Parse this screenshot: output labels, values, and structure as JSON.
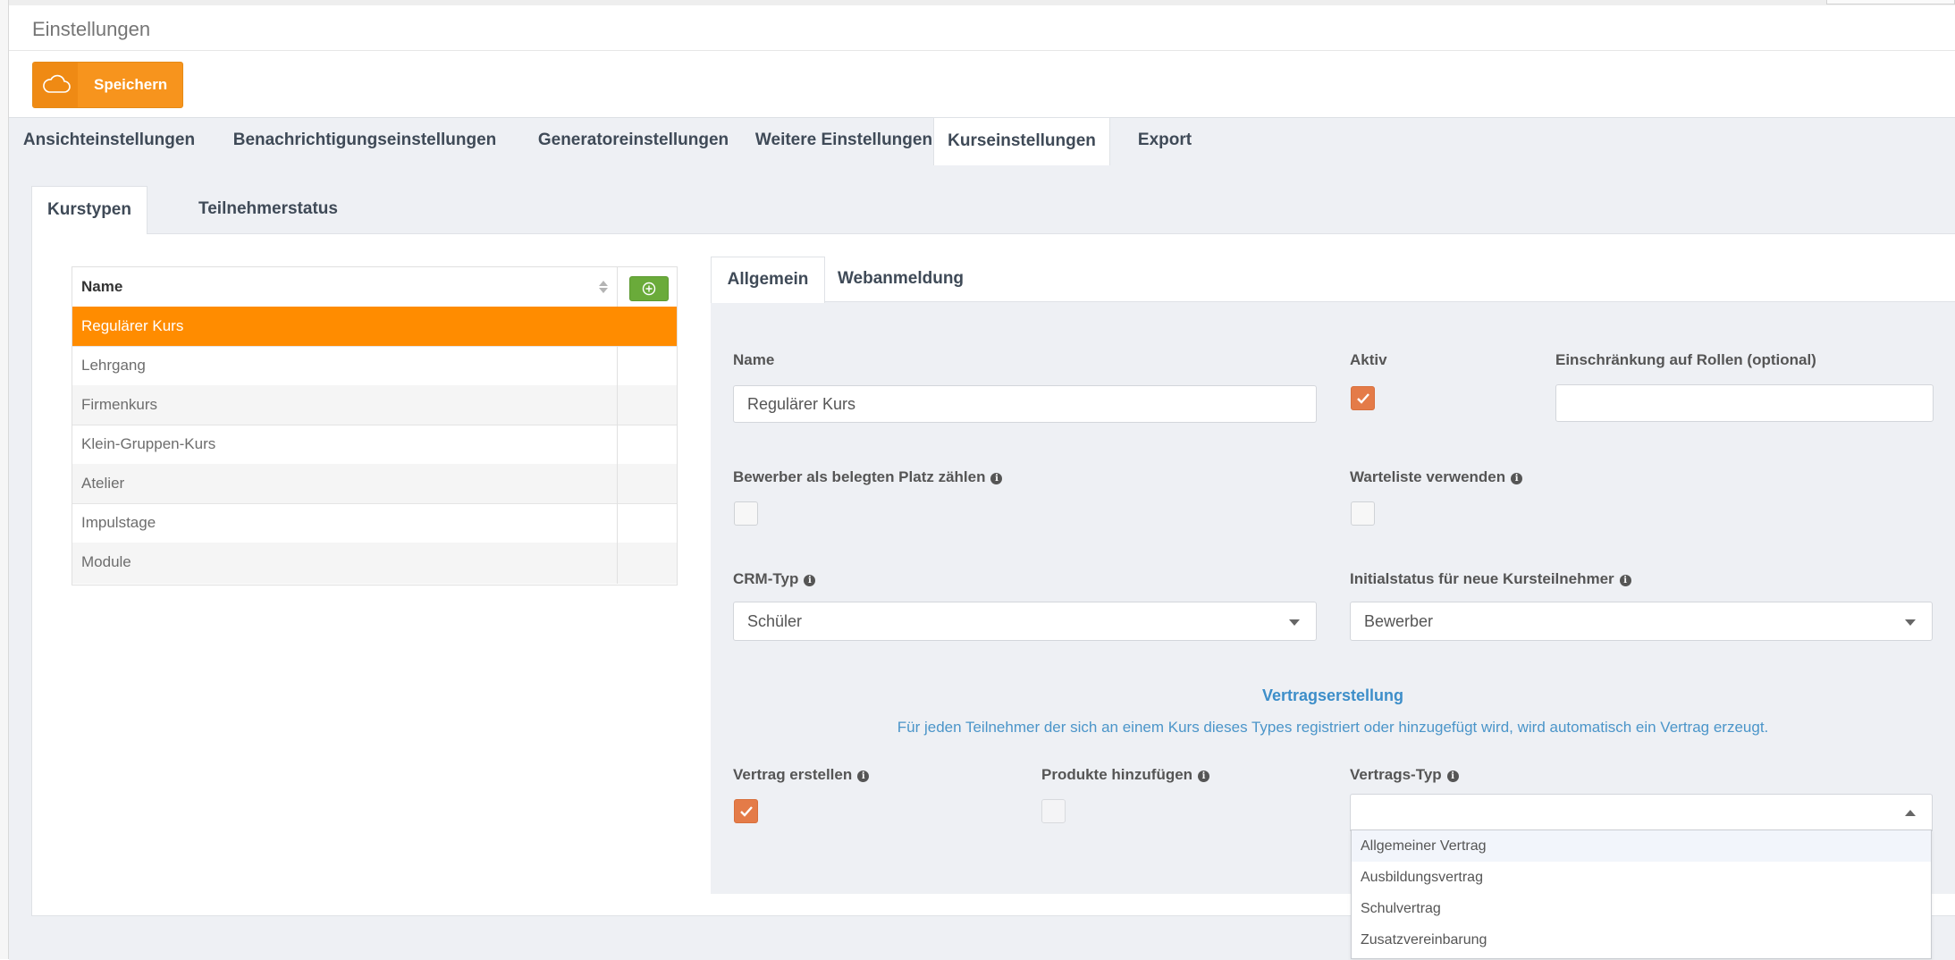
{
  "window": {
    "title": "Einstellungen"
  },
  "toolbar": {
    "save_label": "Speichern",
    "save_icon": "cloud-icon"
  },
  "main_tabs": [
    {
      "label": "Ansichteinstellungen",
      "active": false
    },
    {
      "label": "Benachrichtigungseinstellungen",
      "active": false
    },
    {
      "label": "Generatoreinstellungen",
      "active": false
    },
    {
      "label": "Weitere Einstellungen",
      "active": false
    },
    {
      "label": "Kurseinstellungen",
      "active": true
    },
    {
      "label": "Export",
      "active": false
    }
  ],
  "sub_tabs": [
    {
      "label": "Kurstypen",
      "active": true
    },
    {
      "label": "Teilnehmerstatus",
      "active": false
    }
  ],
  "course_types": {
    "header": "Name",
    "rows": [
      "Regulärer Kurs",
      "Lehrgang",
      "Firmenkurs",
      "Klein-Gruppen-Kurs",
      "Atelier",
      "Impulstage",
      "Module"
    ],
    "selected": "Regulärer Kurs"
  },
  "form_tabs": [
    {
      "label": "Allgemein",
      "active": true
    },
    {
      "label": "Webanmeldung",
      "active": false
    }
  ],
  "form": {
    "name_label": "Name",
    "name_value": "Regulärer Kurs",
    "active_label": "Aktiv",
    "active_checked": true,
    "roles_label": "Einschränkung auf Rollen (optional)",
    "roles_value": "",
    "applicant_label": "Bewerber als belegten Platz zählen",
    "applicant_checked": false,
    "waitlist_label": "Warteliste verwenden",
    "waitlist_checked": false,
    "crm_label": "CRM-Typ",
    "crm_value": "Schüler",
    "initial_status_label": "Initialstatus für neue Kursteilnehmer",
    "initial_status_value": "Bewerber"
  },
  "contract": {
    "title": "Vertragserstellung",
    "description": "Für jeden Teilnehmer der sich an einem Kurs dieses Types registriert oder hinzugefügt wird, wird automatisch ein Vertrag erzeugt.",
    "create_label": "Vertrag erstellen",
    "create_checked": true,
    "products_label": "Produkte hinzufügen",
    "products_checked": false,
    "type_label": "Vertrags-Typ",
    "type_value": "",
    "type_options": [
      "Allgemeiner Vertrag",
      "Ausbildungsvertrag",
      "Schulvertrag",
      "Zusatzvereinbarung"
    ]
  },
  "colors": {
    "accent_orange": "#ff8c00",
    "checkbox_orange": "#e47b48",
    "add_green": "#6aab3a",
    "link_blue": "#3d8ec9"
  }
}
